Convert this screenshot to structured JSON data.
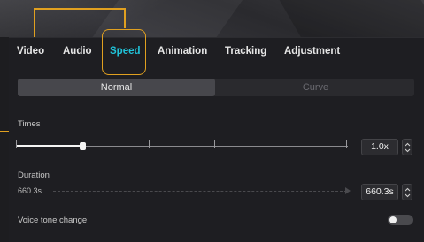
{
  "tabs": [
    {
      "label": "Video",
      "active": false
    },
    {
      "label": "Audio",
      "active": false
    },
    {
      "label": "Speed",
      "active": true
    },
    {
      "label": "Animation",
      "active": false
    },
    {
      "label": "Tracking",
      "active": false
    },
    {
      "label": "Adjustment",
      "active": false
    }
  ],
  "mode": {
    "normal_label": "Normal",
    "curve_label": "Curve",
    "selected": "Normal"
  },
  "times": {
    "label": "Times",
    "value": "1.0x",
    "slider_fraction": 0.2
  },
  "duration": {
    "label": "Duration",
    "start_value": "660.3s",
    "value": "660.3s"
  },
  "voice_tone": {
    "label": "Voice tone change",
    "enabled": false
  },
  "colors": {
    "accent": "#20c2d8",
    "highlight": "#e0a020",
    "background": "#1e1e22"
  }
}
